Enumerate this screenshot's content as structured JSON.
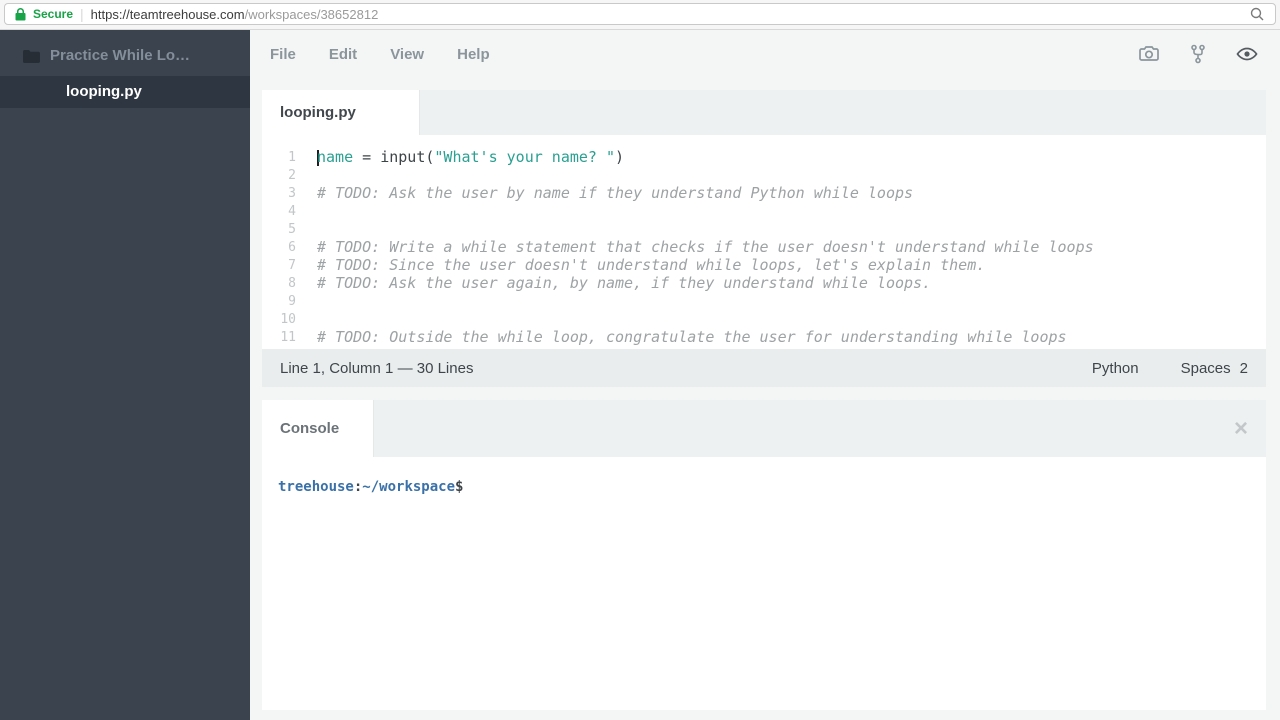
{
  "browser": {
    "secure_label": "Secure",
    "url_main": "https://teamtreehouse.com",
    "url_path": "/workspaces/38652812"
  },
  "sidebar": {
    "project_title": "Practice While Lo…",
    "active_file": "looping.py"
  },
  "menubar": {
    "items": [
      "File",
      "Edit",
      "View",
      "Help"
    ],
    "icons": [
      "camera-icon",
      "fork-icon",
      "eye-icon"
    ]
  },
  "editor": {
    "tab": "looping.py",
    "status_left": "Line 1, Column 1 — 30 Lines",
    "status_lang": "Python",
    "status_indent_label": "Spaces",
    "status_indent_value": "2",
    "lines": [
      {
        "n": "1",
        "cursor": true,
        "segs": [
          {
            "t": "name",
            "c": "ident"
          },
          {
            "t": " = input(",
            "c": "plain"
          },
          {
            "t": "\"What's your name? \"",
            "c": "string"
          },
          {
            "t": ")",
            "c": "plain"
          }
        ]
      },
      {
        "n": "2",
        "segs": []
      },
      {
        "n": "3",
        "segs": [
          {
            "t": "# TODO: Ask the user by name if they understand Python while loops",
            "c": "comment"
          }
        ]
      },
      {
        "n": "4",
        "segs": []
      },
      {
        "n": "5",
        "segs": []
      },
      {
        "n": "6",
        "segs": [
          {
            "t": "# TODO: Write a while statement that checks if the user doesn't understand while loops",
            "c": "comment"
          }
        ]
      },
      {
        "n": "7",
        "segs": [
          {
            "t": "# TODO: Since the user doesn't understand while loops, let's explain them.",
            "c": "comment"
          }
        ]
      },
      {
        "n": "8",
        "segs": [
          {
            "t": "# TODO: Ask the user again, by name, if they understand while loops.",
            "c": "comment"
          }
        ]
      },
      {
        "n": "9",
        "segs": []
      },
      {
        "n": "10",
        "segs": []
      },
      {
        "n": "11",
        "segs": [
          {
            "t": "# TODO: Outside the while loop, congratulate the user for understanding while loops",
            "c": "comment"
          }
        ]
      }
    ]
  },
  "console": {
    "tab": "Console",
    "close_glyph": "×",
    "prompt": [
      {
        "t": "treehouse",
        "c": "user"
      },
      {
        "t": ":",
        "c": "plain"
      },
      {
        "t": "~/workspace",
        "c": "path"
      },
      {
        "t": "$",
        "c": "plain"
      }
    ]
  },
  "colors": {
    "accent_teal": "#2aa092",
    "secure_green": "#18a348",
    "sidebar_bg": "#3a434e",
    "sidebar_selected": "#2e3641",
    "panel_header_bg": "#eef1f1",
    "statusbar_bg": "#e9eded",
    "prompt_blue": "#3a71a8"
  }
}
